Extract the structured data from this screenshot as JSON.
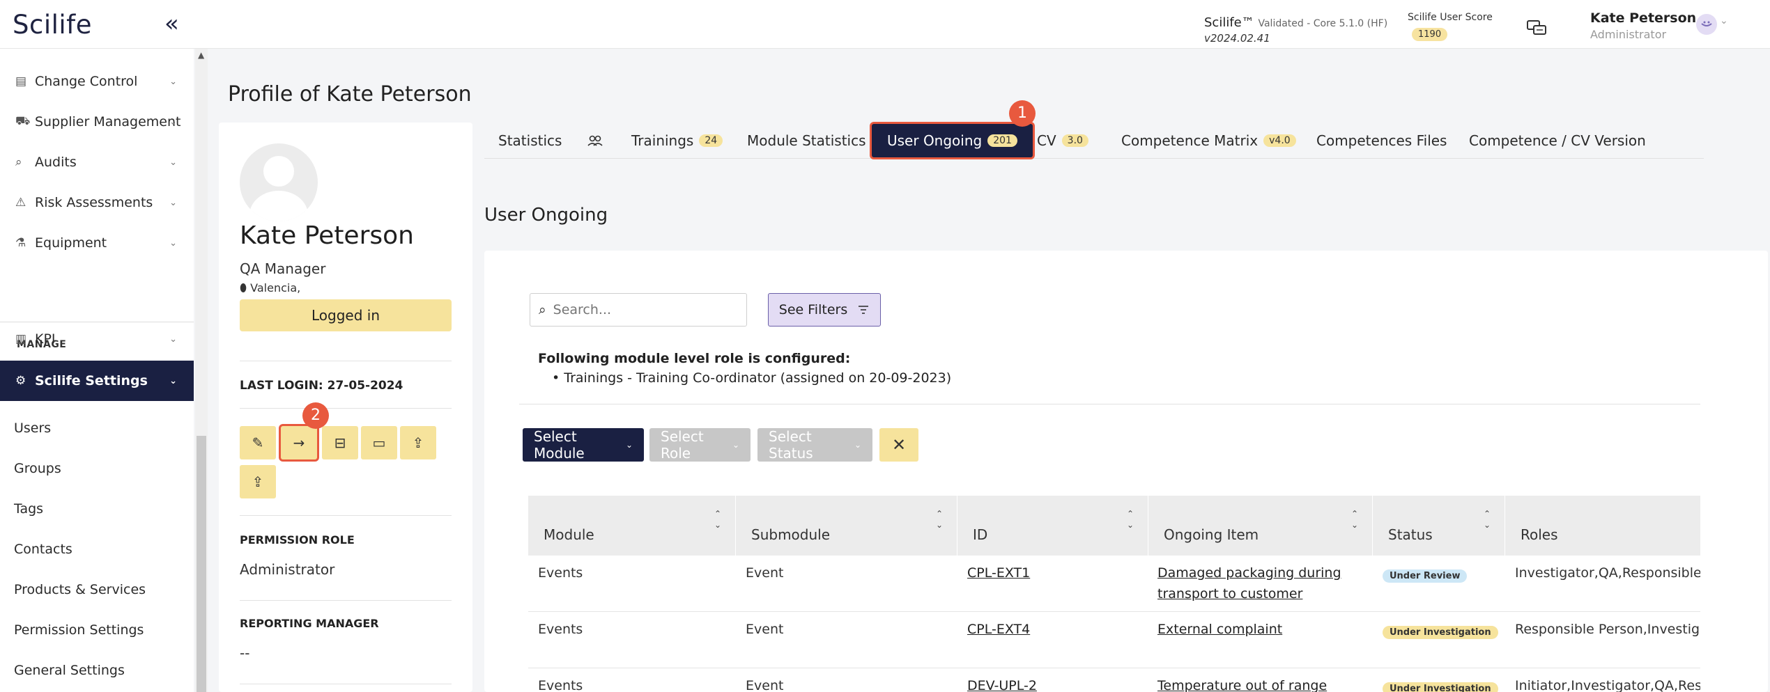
{
  "header": {
    "logo": "Scilife",
    "collapse_icon": "«",
    "brand": "Scilife™",
    "brand_detail": "Validated - Core 5.1.0 (HF)",
    "version": "v2024.02.41",
    "score_label": "Scilife User Score",
    "score": "1190",
    "user_name": "Kate Peterson",
    "user_role": "Administrator"
  },
  "sidebar": {
    "top_items": [
      {
        "label": "Change Control",
        "icon": "document-icon"
      },
      {
        "label": "Supplier Management",
        "icon": "truck-icon"
      },
      {
        "label": "Audits",
        "icon": "search-icon"
      },
      {
        "label": "Risk Assessments",
        "icon": "warning-icon"
      },
      {
        "label": "Equipment",
        "icon": "flask-icon"
      }
    ],
    "section_label": "MANAGE",
    "kpi": "KPI",
    "active": "Scilife Settings",
    "sub_items": [
      "Users",
      "Groups",
      "Tags",
      "Contacts",
      "Products & Services",
      "Permission Settings",
      "General Settings"
    ]
  },
  "page": {
    "title": "Profile of Kate Peterson"
  },
  "profile": {
    "name": "Kate Peterson",
    "role": "QA Manager",
    "location": "Valencia,",
    "status": "Logged in",
    "last_login": "LAST LOGIN: 27-05-2024",
    "permission_label": "PERMISSION ROLE",
    "permission_value": "Administrator",
    "reporting_label": "REPORTING MANAGER",
    "reporting_value": "--"
  },
  "tabs": [
    {
      "label": "Statistics",
      "badge": ""
    },
    {
      "label": "",
      "badge": ""
    },
    {
      "label": "Trainings",
      "badge": "24"
    },
    {
      "label": "Module Statistics",
      "badge": ""
    },
    {
      "label": "User Ongoing",
      "badge": "201"
    },
    {
      "label": "CV",
      "badge": "3.0"
    },
    {
      "label": "Competence Matrix",
      "badge": "v4.0"
    },
    {
      "label": "Competences Files",
      "badge": ""
    },
    {
      "label": "Competence / CV Version",
      "badge": ""
    }
  ],
  "callouts": [
    "1",
    "2"
  ],
  "content": {
    "section_title": "User Ongoing",
    "search_placeholder": "Search...",
    "see_filters": "See Filters",
    "role_title": "Following module level role is configured:",
    "role_item": "Trainings - Training Co-ordinator (assigned on 20-09-2023)",
    "select_module": "Select Module",
    "select_role": "Select Role",
    "select_status": "Select Status"
  },
  "table": {
    "columns": [
      "Module",
      "Submodule",
      "ID",
      "Ongoing Item",
      "Status",
      "Roles"
    ],
    "rows": [
      {
        "module": "Events",
        "submodule": "Event",
        "id": "CPL-EXT1",
        "item": "Damaged packaging during transport to customer",
        "status": "Under Review",
        "roles": "Investigator,QA,Responsible P"
      },
      {
        "module": "Events",
        "submodule": "Event",
        "id": "CPL-EXT4",
        "item": "External complaint",
        "status": "Under Investigation",
        "roles": "Responsible Person,Investiga"
      },
      {
        "module": "Events",
        "submodule": "Event",
        "id": "DEV-UPL-2",
        "item": "Temperature out of range",
        "status": "Under Investigation",
        "roles": "Initiator,Investigator,QA,Respo"
      }
    ]
  },
  "colors": {
    "navy": "#1a2042",
    "yellow": "#f6e39c",
    "callout": "#e8593e",
    "lavender": "#e3dcf4"
  }
}
